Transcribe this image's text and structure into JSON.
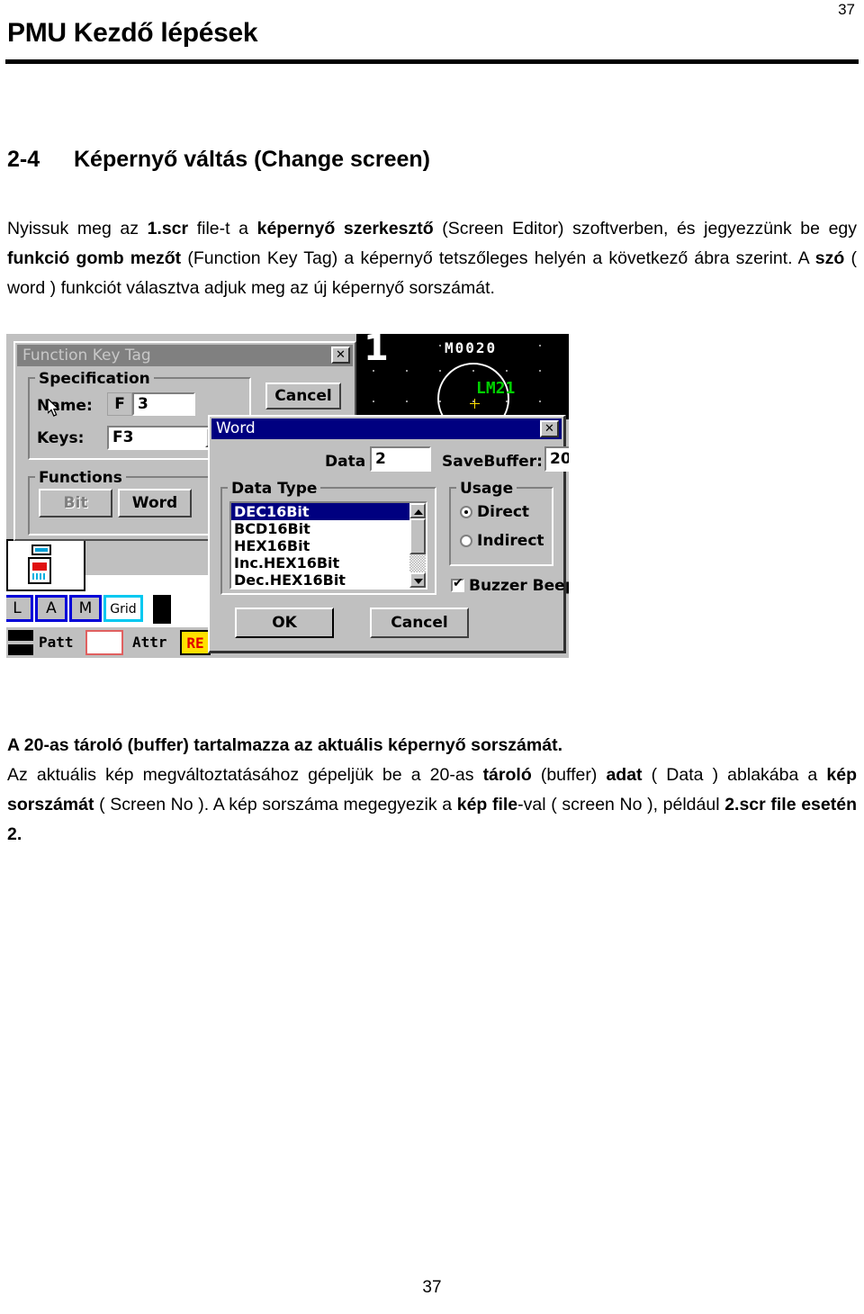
{
  "document": {
    "page_number_top": "37",
    "header_title": "PMU Kezdő lépések",
    "page_number_bottom": "37"
  },
  "section": {
    "number": "2-4",
    "title": "Képernyő váltás (Change screen)"
  },
  "paragraphs": {
    "intro_1": "Nyissuk meg az ",
    "intro_b1": "1.scr",
    "intro_2": " file-t a ",
    "intro_b2": "képernyő szerkesztő",
    "intro_3": " (Screen Editor) szoftverben, és jegyezzünk be egy ",
    "intro_b3": "funkció gomb mezőt",
    "intro_4": " (Function Key Tag) a képernyő tetszőleges helyén a következő ábra szerint. A ",
    "intro_b4": "szó",
    "intro_5": " ( word ) funkciót választva adjuk meg az új képernyő sorszámát.",
    "after_bold": "A 20-as tároló (buffer) tartalmazza az aktuális képernyő sorszámát.",
    "after_1": "Az aktuális kép megváltoztatásához gépeljük be a 20-as ",
    "after_b1": "tároló",
    "after_2": " (buffer) ",
    "after_b2": "adat",
    "after_3": " ( Data ) ablakába a ",
    "after_b3": "kép sorszámát",
    "after_4": " ( Screen No ). A kép sorszáma megegyezik a ",
    "after_b4": "kép file",
    "after_5": "-val ( screen No ), például  ",
    "after_b5": "2.scr file esetén 2."
  },
  "screenshot": {
    "editor_canvas": {
      "screen_number": "1",
      "device_label": "M0020",
      "tag_label": "LM21"
    },
    "editor_toolbar": {
      "buttons": [
        "L",
        "A",
        "M",
        "Grid"
      ],
      "status": {
        "pattern_label": "Patt",
        "attribute_label": "Attr",
        "attribute_value": "RE"
      }
    },
    "function_key_tag_dialog": {
      "title": "Function Key Tag",
      "close_label": "✕",
      "specification_group": "Specification",
      "name_label": "Name:",
      "name_prefix": "F",
      "name_value": "3",
      "keys_label": "Keys:",
      "keys_value": "F3",
      "functions_group": "Functions",
      "bit_button": "Bit",
      "word_button": "Word",
      "cancel_button": "Cancel"
    },
    "word_dialog": {
      "title": "Word",
      "close_label": "✕",
      "data_label": "Data",
      "data_value": "2",
      "savebuffer_label": "SaveBuffer:",
      "savebuffer_value": "20",
      "data_type_group": "Data Type",
      "data_type_items": [
        "DEC16Bit",
        "BCD16Bit",
        "HEX16Bit",
        "Inc.HEX16Bit",
        "Dec.HEX16Bit"
      ],
      "data_type_selected": "DEC16Bit",
      "usage_group": "Usage",
      "usage_direct": "Direct",
      "usage_indirect": "Indirect",
      "usage_selected": "Direct",
      "buzzer_beep_label": "Buzzer Beep",
      "buzzer_beep_checked": true,
      "ok_button": "OK",
      "cancel_button": "Cancel"
    }
  },
  "colors": {
    "dialog_face": "#c0c0c0",
    "active_title": "#000080",
    "inactive_title": "#808080",
    "selection": "#000080",
    "canvas_bg": "#000000",
    "tag_green": "#00d000",
    "cursor_yellow": "#ffe000",
    "attr_yellow": "#ffe000",
    "attr_red": "#e00000"
  }
}
